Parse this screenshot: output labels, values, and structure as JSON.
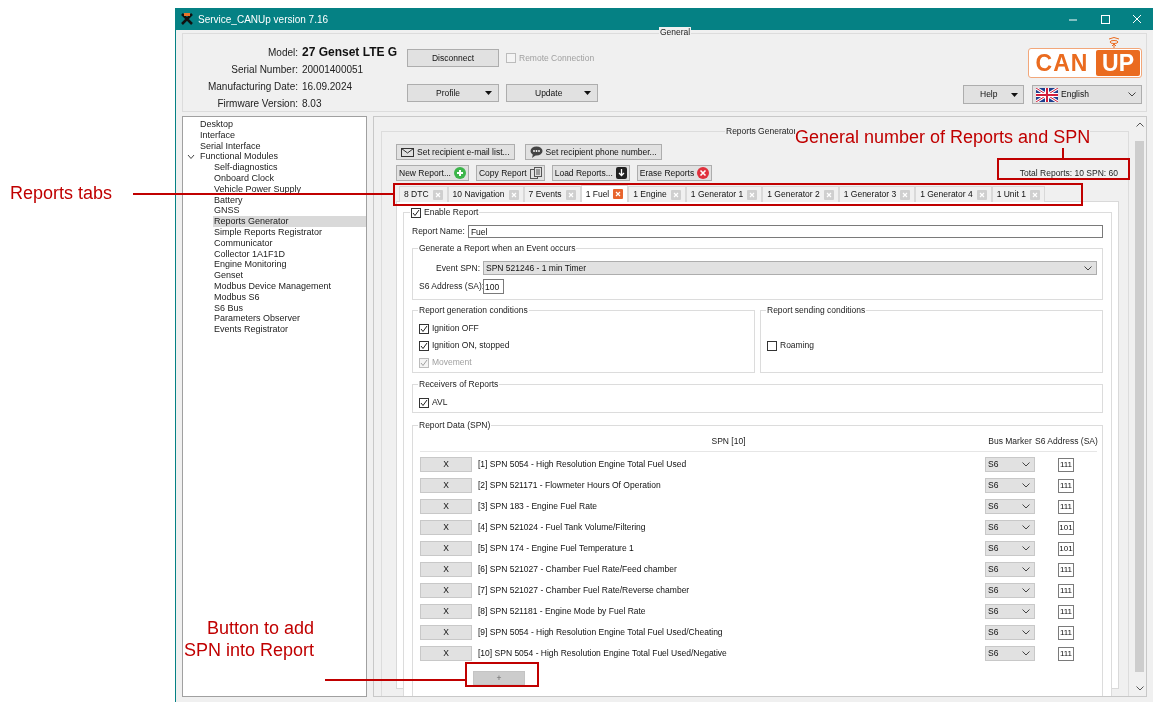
{
  "window": {
    "title": "Service_CANUp version 7.16"
  },
  "general": {
    "legend": "General",
    "info": [
      {
        "label": "Model:",
        "value": "27 Genset LTE G",
        "kind": "bold"
      },
      {
        "label": "Serial Number:",
        "value": "20001400051",
        "kind": "plain"
      },
      {
        "label": "Manufacturing Date:",
        "value": "16.09.2024",
        "kind": "plain"
      },
      {
        "label": "Firmware Version:",
        "value": "8.03",
        "kind": "plain"
      }
    ],
    "disconnect": "Disconnect",
    "remote_connection": {
      "label": "Remote Connection",
      "checked": false,
      "disabled": true
    },
    "profile": "Profile",
    "update": "Update",
    "logo": {
      "left": "CAN",
      "right": "UP"
    },
    "help": "Help",
    "language": "English"
  },
  "sidebar": {
    "items": [
      {
        "label": "Desktop",
        "selected": false
      },
      {
        "label": "Interface",
        "selected": false
      },
      {
        "label": "Serial Interface",
        "selected": false
      },
      {
        "label": "Functional Modules",
        "selected": false,
        "expanded": true,
        "children": [
          {
            "label": "Self-diagnostics",
            "selected": false
          },
          {
            "label": "Onboard Clock",
            "selected": false
          },
          {
            "label": "Vehicle Power Supply",
            "selected": false
          },
          {
            "label": "Battery",
            "selected": false
          },
          {
            "label": "GNSS",
            "selected": false
          },
          {
            "label": "Reports Generator",
            "selected": true
          },
          {
            "label": "Simple Reports Registrator",
            "selected": false
          },
          {
            "label": "Communicator",
            "selected": false
          },
          {
            "label": "Collector 1A1F1D",
            "selected": false
          },
          {
            "label": "Engine Monitoring",
            "selected": false
          },
          {
            "label": "Genset",
            "selected": false
          },
          {
            "label": "Modbus Device Management",
            "selected": false
          },
          {
            "label": "Modbus S6",
            "selected": false
          },
          {
            "label": "S6 Bus",
            "selected": false
          },
          {
            "label": "Parameters Observer",
            "selected": false
          },
          {
            "label": "Events Registrator",
            "selected": false
          }
        ]
      }
    ]
  },
  "reports_generator": {
    "legend": "Reports Generator",
    "recipient_buttons": [
      {
        "label": "Set recipient e-mail list...",
        "kind": "mail"
      },
      {
        "label": "Set recipient phone number...",
        "kind": "chat"
      }
    ],
    "action_buttons": [
      {
        "label": "New Report...",
        "kind": "add"
      },
      {
        "label": "Copy Report",
        "kind": "copy"
      },
      {
        "label": "Load Reports...",
        "kind": "load"
      },
      {
        "label": "Erase Reports",
        "kind": "erase"
      }
    ],
    "total": "Total Reports: 10 SPN: 60",
    "tabs": [
      {
        "label": "8 DTC",
        "selected": false
      },
      {
        "label": "10 Navigation",
        "selected": false
      },
      {
        "label": "7 Events",
        "selected": false
      },
      {
        "label": "1 Fuel",
        "selected": true
      },
      {
        "label": "1 Engine",
        "selected": false
      },
      {
        "label": "1 Generator 1",
        "selected": false
      },
      {
        "label": "1 Generator 2",
        "selected": false
      },
      {
        "label": "1 Generator 3",
        "selected": false
      },
      {
        "label": "1 Generator 4",
        "selected": false
      },
      {
        "label": "1 Unit 1",
        "selected": false
      }
    ],
    "form": {
      "enable": {
        "label": "Enable Report",
        "checked": true
      },
      "report_name": {
        "label": "Report Name:",
        "value": "Fuel"
      },
      "event_group": {
        "legend": "Generate a Report when an Event occurs",
        "event_spn": {
          "label": "Event SPN:",
          "value": "SPN 521246 - 1 min Timer"
        },
        "s6_address": {
          "label": "S6 Address (SA):",
          "value": "100"
        }
      },
      "generation_conditions": {
        "legend": "Report generation conditions",
        "items": [
          {
            "label": "Ignition OFF",
            "checked": true,
            "disabled": false
          },
          {
            "label": "Ignition ON, stopped",
            "checked": true,
            "disabled": false
          },
          {
            "label": "Movement",
            "checked": true,
            "disabled": true
          }
        ]
      },
      "sending_conditions": {
        "legend": "Report sending conditions",
        "items": [
          {
            "label": "Roaming",
            "checked": false,
            "disabled": false
          }
        ]
      },
      "receivers": {
        "legend": "Receivers of Reports",
        "items": [
          {
            "label": "AVL",
            "checked": true,
            "disabled": false
          }
        ]
      },
      "report_data": {
        "legend": "Report Data (SPN)",
        "columns": [
          "SPN [10]",
          "Bus Marker",
          "S6 Address (SA)"
        ],
        "rows": [
          {
            "remove": "X",
            "spn": "[1] SPN 5054 - High Resolution Engine Total Fuel Used",
            "bus": "S6",
            "address": "111"
          },
          {
            "remove": "X",
            "spn": "[2] SPN 521171 - Flowmeter Hours Of Operation",
            "bus": "S6",
            "address": "111"
          },
          {
            "remove": "X",
            "spn": "[3] SPN 183 - Engine Fuel Rate",
            "bus": "S6",
            "address": "111"
          },
          {
            "remove": "X",
            "spn": "[4] SPN 521024 - Fuel Tank Volume/Filtering",
            "bus": "S6",
            "address": "101"
          },
          {
            "remove": "X",
            "spn": "[5] SPN 174 - Engine Fuel Temperature 1",
            "bus": "S6",
            "address": "101"
          },
          {
            "remove": "X",
            "spn": "[6] SPN 521027 - Chamber Fuel Rate/Feed chamber",
            "bus": "S6",
            "address": "111"
          },
          {
            "remove": "X",
            "spn": "[7] SPN 521027 - Chamber Fuel Rate/Reverse chamber",
            "bus": "S6",
            "address": "111"
          },
          {
            "remove": "X",
            "spn": "[8] SPN 521181 - Engine Mode by Fuel Rate",
            "bus": "S6",
            "address": "111"
          },
          {
            "remove": "X",
            "spn": "[9] SPN 5054 - High Resolution Engine Total Fuel Used/Cheating",
            "bus": "S6",
            "address": "111"
          },
          {
            "remove": "X",
            "spn": "[10] SPN 5054 - High Resolution Engine Total Fuel Used/Negative",
            "bus": "S6",
            "address": "111"
          }
        ],
        "add_button": "+"
      }
    }
  },
  "annotations": [
    {
      "text": "Reports tabs",
      "kind": "tabs"
    },
    {
      "text": "General number of Reports and SPN",
      "kind": "total"
    },
    {
      "text": "Button to add SPN into Report",
      "kind": "add"
    }
  ]
}
